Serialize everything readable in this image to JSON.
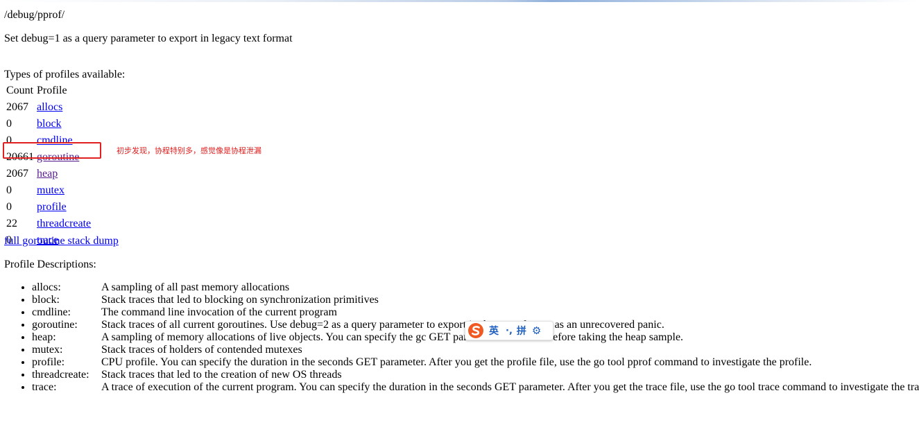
{
  "page": {
    "title": "/debug/pprof/",
    "note": "Set debug=1 as a query parameter to export in legacy text format",
    "types_heading": "Types of profiles available:",
    "table": {
      "headers": [
        "Count",
        "Profile"
      ],
      "rows": [
        {
          "count": "2067",
          "profile": "allocs"
        },
        {
          "count": "0",
          "profile": "block"
        },
        {
          "count": "0",
          "profile": "cmdline"
        },
        {
          "count": "20661",
          "profile": "goroutine"
        },
        {
          "count": "2067",
          "profile": "heap"
        },
        {
          "count": "0",
          "profile": "mutex"
        },
        {
          "count": "0",
          "profile": "profile"
        },
        {
          "count": "22",
          "profile": "threadcreate"
        },
        {
          "count": "0",
          "profile": "trace"
        }
      ]
    },
    "dump_link": "full goroutine stack dump",
    "desc_heading": "Profile Descriptions:",
    "descriptions": [
      {
        "key": "allocs:",
        "text": "A sampling of all past memory allocations"
      },
      {
        "key": "block:",
        "text": "Stack traces that led to blocking on synchronization primitives"
      },
      {
        "key": "cmdline:",
        "text": "The command line invocation of the current program"
      },
      {
        "key": "goroutine:",
        "text": "Stack traces of all current goroutines. Use debug=2 as a query parameter to export in the same format as an unrecovered panic."
      },
      {
        "key": "heap:",
        "text": "A sampling of memory allocations of live objects. You can specify the gc GET parameter to run GC before taking the heap sample."
      },
      {
        "key": "mutex:",
        "text": "Stack traces of holders of contended mutexes"
      },
      {
        "key": "profile:",
        "text": "CPU profile. You can specify the duration in the seconds GET parameter. After you get the profile file, use the go tool pprof command to investigate the profile."
      },
      {
        "key": "threadcreate:",
        "text": "Stack traces that led to the creation of new OS threads"
      },
      {
        "key": "trace:",
        "text": "A trace of execution of the current program. You can specify the duration in the seconds GET parameter. After you get the trace file, use the go tool trace command to investigate the trace."
      }
    ]
  },
  "annotation": {
    "text": "初步发现，协程特别多，感觉像是协程泄漏",
    "color": "#e02020"
  },
  "ime_toolbar": {
    "logo_icon": "sogou-logo-icon",
    "lang": "英",
    "punct": "·,",
    "mode": "拼",
    "settings_icon": "gear-icon",
    "accent": "#1f5fbf"
  },
  "colors": {
    "link": "#0000ee",
    "visited_link": "#551a8b",
    "highlight": "#e02020"
  }
}
